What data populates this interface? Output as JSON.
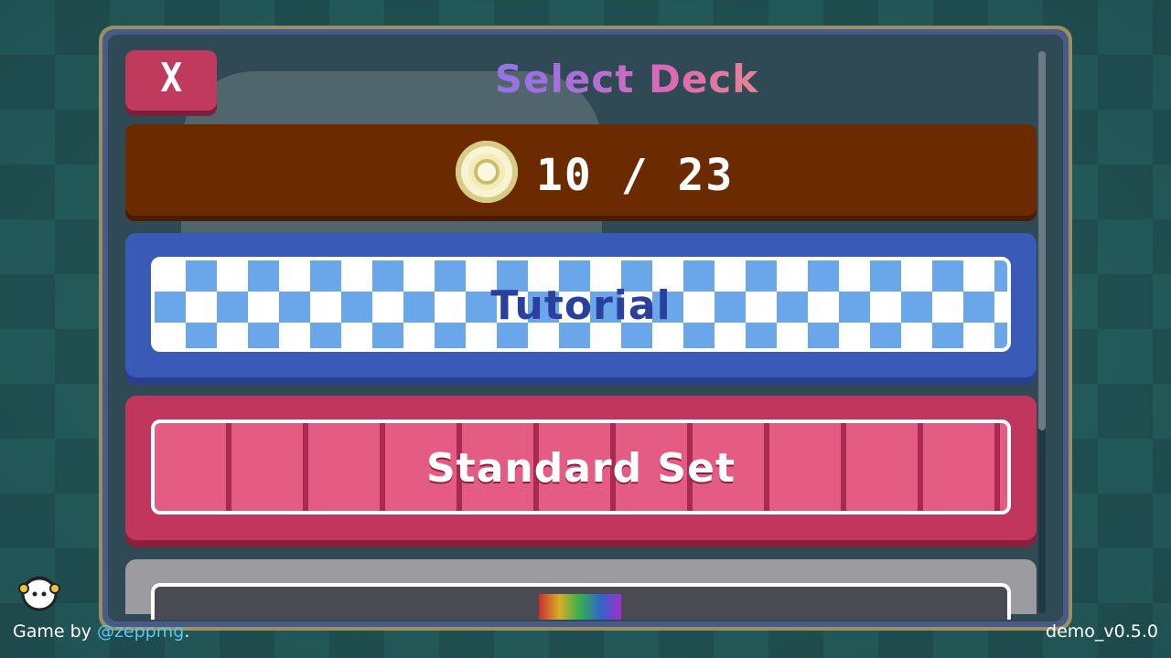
{
  "header": {
    "title": "Select Deck",
    "close_label": "X"
  },
  "currency": {
    "icon": "coin-icon",
    "count": "10 / 23"
  },
  "decks": [
    {
      "label": "Tutorial",
      "color": "#3a5ab8"
    },
    {
      "label": "Standard Set",
      "color": "#c0365c"
    },
    {
      "label": "",
      "color": "#9c9ca0"
    }
  ],
  "footer": {
    "credit_prefix": "Game by ",
    "credit_handle": "@zeppmg",
    "credit_suffix": ".",
    "version": "demo_v0.5.0"
  },
  "colors": {
    "accent_blue": "#3a5ab8",
    "accent_pink": "#c0365c",
    "coin_bar": "#6b2a00",
    "panel_bg": "#2f4a55"
  }
}
